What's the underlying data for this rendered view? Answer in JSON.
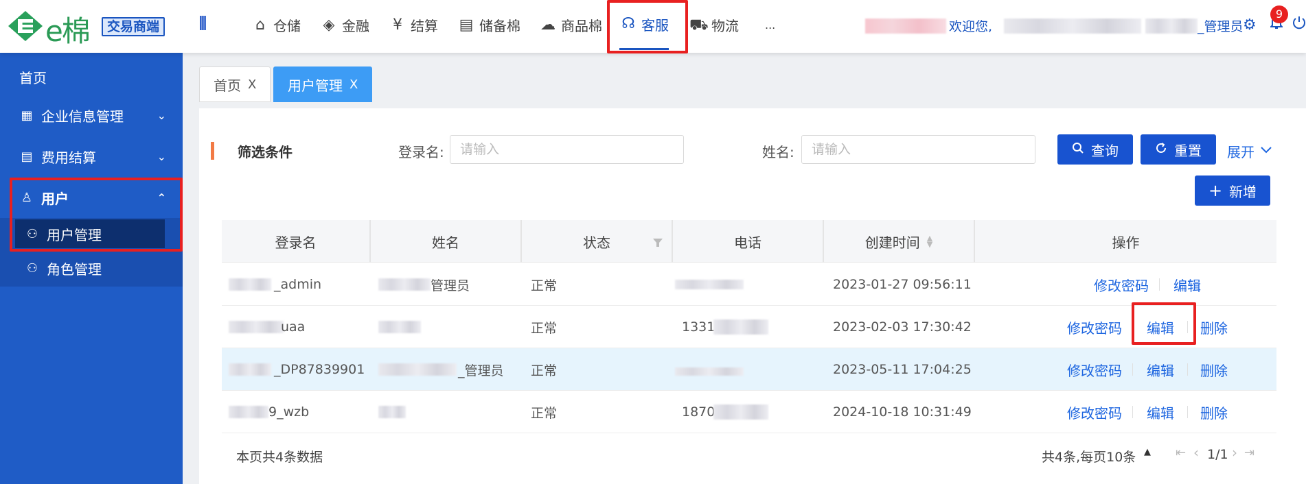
{
  "brand": {
    "logo_text": "e棉",
    "badge": "交易商端"
  },
  "header": {
    "collapse_icon": "⫴",
    "nav": [
      {
        "label": "仓储",
        "icon": "warehouse-icon",
        "glyph": "⌂"
      },
      {
        "label": "金融",
        "icon": "finance-icon",
        "glyph": "◈"
      },
      {
        "label": "结算",
        "icon": "yen-icon",
        "glyph": "¥"
      },
      {
        "label": "储备棉",
        "icon": "document-icon",
        "glyph": "▤"
      },
      {
        "label": "商品棉",
        "icon": "cloud-icon",
        "glyph": "☁"
      },
      {
        "label": "客服",
        "icon": "headset-icon",
        "glyph": "☊"
      },
      {
        "label": "物流",
        "icon": "truck-icon",
        "glyph": "⛟"
      },
      {
        "label": "...",
        "icon": "more-icon",
        "glyph": ""
      }
    ],
    "welcome": "欢迎您,",
    "role": "_管理员",
    "notification_count": "9"
  },
  "sidebar": {
    "home": "首页",
    "items": [
      {
        "label": "企业信息管理",
        "icon": "building-icon"
      },
      {
        "label": "费用结算",
        "icon": "fee-icon"
      },
      {
        "label": "用户",
        "icon": "user-icon"
      }
    ],
    "sub_items": [
      "用户管理",
      "角色管理"
    ]
  },
  "tabs": [
    {
      "label": "首页",
      "close": "X"
    },
    {
      "label": "用户管理",
      "close": "X"
    }
  ],
  "filter": {
    "title": "筛选条件",
    "login_label": "登录名:",
    "login_placeholder": "请输入",
    "name_label": "姓名:",
    "name_placeholder": "请输入",
    "search": "查询",
    "reset": "重置",
    "expand": "展开",
    "add": "新增"
  },
  "table": {
    "headers": [
      "登录名",
      "姓名",
      "状态",
      "电话",
      "创建时间",
      "操作"
    ],
    "rows": [
      {
        "login": "_admin",
        "name": "管理员",
        "status": "正常",
        "phone": "",
        "created": "2023-01-27 09:56:11",
        "ops": [
          "修改密码",
          "编辑"
        ]
      },
      {
        "login": "uaa",
        "name": "",
        "status": "正常",
        "phone": "1331",
        "created": "2023-02-03 17:30:42",
        "ops": [
          "修改密码",
          "编辑",
          "删除"
        ]
      },
      {
        "login": "_DP87839901",
        "name": "_管理员",
        "status": "正常",
        "phone": "",
        "created": "2023-05-11 17:04:25",
        "ops": [
          "修改密码",
          "编辑",
          "删除"
        ]
      },
      {
        "login": "9_wzb",
        "name": "",
        "status": "正常",
        "phone": "1870",
        "created": "2024-10-18 10:31:49",
        "ops": [
          "修改密码",
          "编辑",
          "删除"
        ]
      }
    ]
  },
  "footer": {
    "page_count": "本页共4条数据",
    "total": "共4条,每页10条",
    "page": "1/1"
  },
  "colors": {
    "primary": "#1853d0",
    "sidebar": "#1f5cc6",
    "highlight": "#e82020",
    "accent": "#f27a45"
  }
}
